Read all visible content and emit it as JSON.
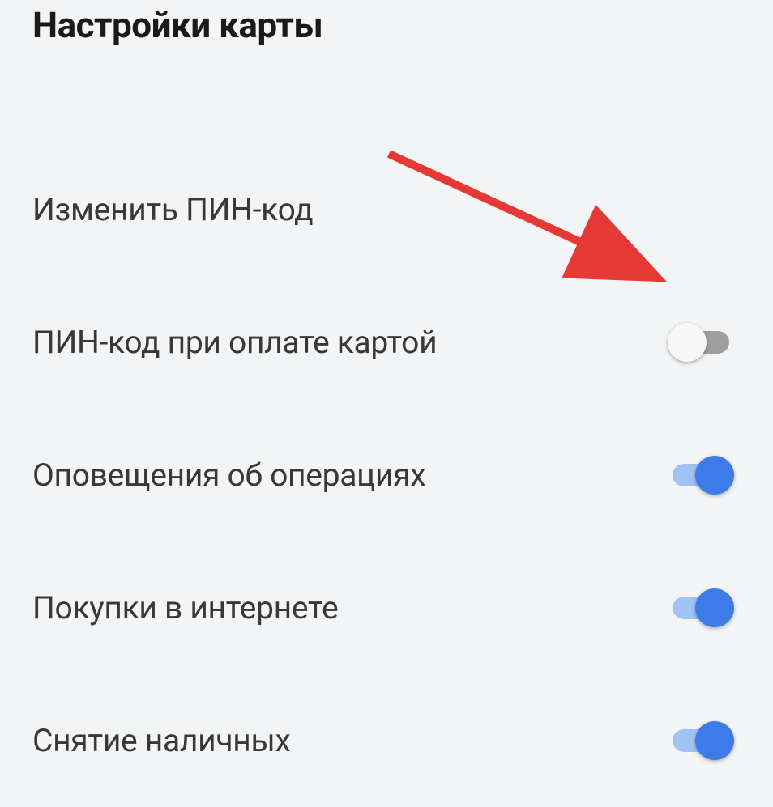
{
  "title": "Настройки карты",
  "settings": {
    "items": [
      {
        "label": "Изменить ПИН-код",
        "has_toggle": false
      },
      {
        "label": "ПИН-код при оплате картой",
        "has_toggle": true,
        "enabled": false
      },
      {
        "label": "Оповещения об операциях",
        "has_toggle": true,
        "enabled": true
      },
      {
        "label": "Покупки в интернете",
        "has_toggle": true,
        "enabled": true
      },
      {
        "label": "Снятие наличных",
        "has_toggle": true,
        "enabled": true
      }
    ]
  },
  "colors": {
    "accent": "#3d7ce8",
    "track_on": "#9fc4f4",
    "track_off": "#9e9e9e",
    "thumb_off": "#f7f7f7",
    "background": "#f3f4f5",
    "text": "#383838",
    "title": "#1a1a1a",
    "arrow": "#e53935"
  },
  "annotation": {
    "type": "arrow",
    "points_to": "toggle-pin-on-pay"
  }
}
